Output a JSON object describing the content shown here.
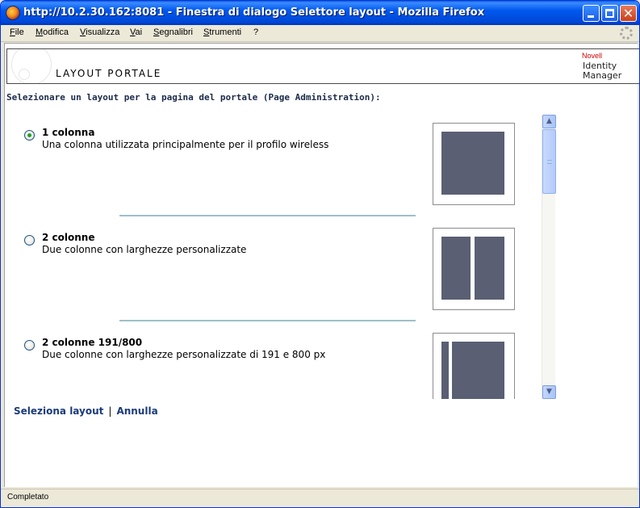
{
  "window": {
    "title": "http://10.2.30.162:8081 - Finestra di dialogo Selettore layout - Mozilla Firefox",
    "close_glyph": "✕"
  },
  "menubar": {
    "items": [
      "File",
      "Modifica",
      "Visualizza",
      "Vai",
      "Segnalibri",
      "Strumenti",
      "?"
    ]
  },
  "header": {
    "title": "LAYOUT PORTALE",
    "brand_small": "Novell",
    "brand_line1": "Identity",
    "brand_line2": "Manager"
  },
  "prompt": "Selezionare un layout per la pagina del portale (Page Administration):",
  "layouts": [
    {
      "name": "1 colonna",
      "description": "Una colonna utilizzata principalmente per il profilo wireless",
      "selected": true
    },
    {
      "name": "2 colonne",
      "description": "Due colonne con larghezze personalizzate",
      "selected": false
    },
    {
      "name": "2 colonne 191/800",
      "description": "Due colonne con larghezze personalizzate di 191 e 800 px",
      "selected": false
    }
  ],
  "actions": {
    "select": "Seleziona layout",
    "separator": "|",
    "cancel": "Annulla"
  },
  "status": "Completato",
  "icons": {
    "app": "firefox-icon",
    "minimize": "minimize-icon",
    "maximize": "maximize-icon",
    "close": "close-icon",
    "throbber": "throbber-icon",
    "scroll_up": "▲",
    "scroll_down": "▼"
  },
  "colors": {
    "thumb_fill": "#5a5f73",
    "link": "#1b3b7a",
    "titlebar": "#0058ee"
  }
}
